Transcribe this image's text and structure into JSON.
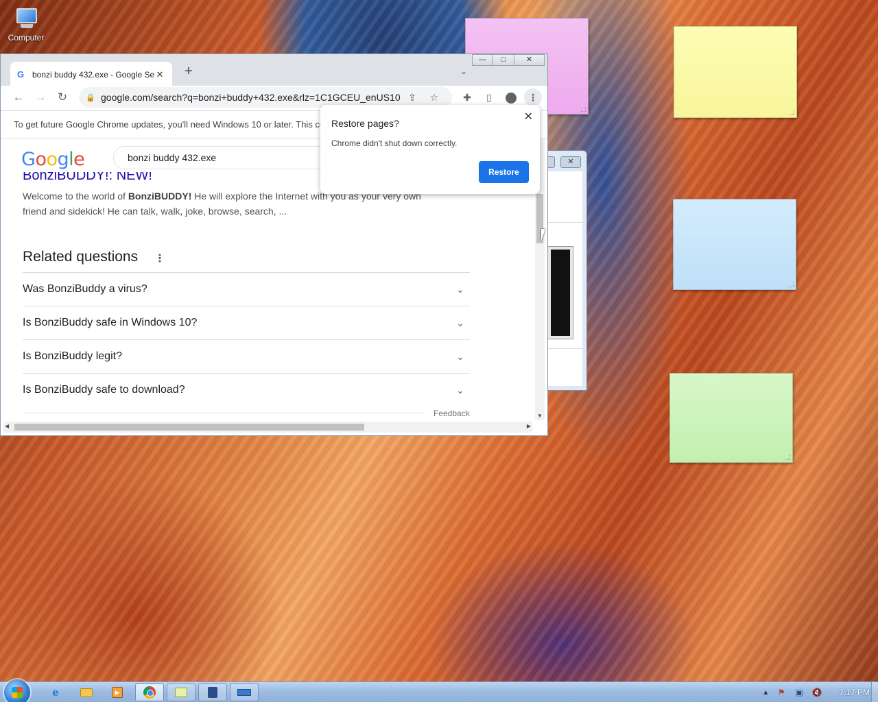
{
  "desktop": {
    "icons": [
      {
        "label": "Computer",
        "icon": "computer-icon"
      }
    ]
  },
  "browser": {
    "tab": {
      "title": "bonzi buddy 432.exe - Google Se",
      "favicon": "G"
    },
    "new_tab": "+",
    "tab_list": "⌄",
    "url": "google.com/search?q=bonzi+buddy+432.exe&rlz=1C1GCEU_enUS10...",
    "infobar_text": "To get future Google Chrome updates, you'll need Windows 10 or later. This co",
    "window_buttons": {
      "minimize": "—",
      "maximize": "□",
      "close": "✕"
    }
  },
  "google": {
    "logo": [
      "G",
      "o",
      "o",
      "g",
      "l",
      "e"
    ],
    "search_query": "bonzi buddy 432.exe",
    "result": {
      "title": "BonziBUDDY!: NEW!",
      "snippet_pre": "Welcome to the world of ",
      "snippet_bold1": "BonziBUDDY!",
      "snippet_mid": " He will explore the Internet with you as your very own friend and sidekick! He can talk, walk, joke, browse, search, ..."
    },
    "related_title": "Related questions",
    "related_questions": [
      "Was BonziBuddy a virus?",
      "Is BonziBuddy safe in Windows 10?",
      "Is BonziBuddy legit?",
      "Is BonziBuddy safe to download?"
    ],
    "feedback": "Feedback"
  },
  "restore_dialog": {
    "title": "Restore pages?",
    "message": "Chrome didn't shut down correctly.",
    "button": "Restore",
    "close": "✕"
  },
  "taskbar": {
    "apps": [
      "ie-icon",
      "folder-icon",
      "media-player-icon",
      "chrome-icon",
      "sticky-notes-icon",
      "virtualbox-icon",
      "on-screen-keyboard-icon"
    ],
    "clock": "7:17 PM"
  },
  "colors": {
    "accent": "#1a73e8",
    "link": "#1a0dab"
  }
}
